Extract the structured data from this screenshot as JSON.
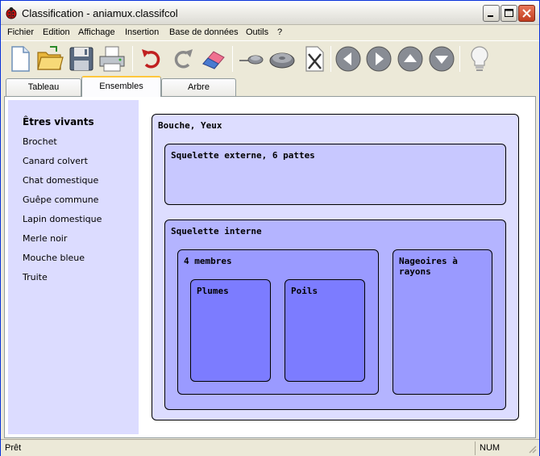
{
  "window": {
    "title": "Classification - aniamux.classifcol"
  },
  "menu": [
    "Fichier",
    "Edition",
    "Affichage",
    "Insertion",
    "Base de données",
    "Outils",
    "?"
  ],
  "toolbar": [
    "new-document-icon",
    "open-folder-icon",
    "save-disk-icon",
    "print-icon",
    "undo-icon",
    "redo-icon",
    "eraser-icon",
    "pin-icon",
    "disc-icon",
    "delete-x-icon",
    "arrow-left-icon",
    "arrow-right-icon",
    "arrow-up-icon",
    "arrow-down-icon",
    "lightbulb-icon"
  ],
  "tabs": [
    "Tableau",
    "Ensembles",
    "Arbre"
  ],
  "active_tab": "Ensembles",
  "sidebar": {
    "title": "Êtres vivants",
    "items": [
      "Brochet",
      "Canard colvert",
      "Chat domestique",
      "Guêpe commune",
      "Lapin domestique",
      "Merle noir",
      "Mouche bleue",
      "Truite"
    ]
  },
  "sets": {
    "outer": {
      "label": "Bouche, Yeux",
      "color": "#ddddff"
    },
    "external": {
      "label": "Squelette externe, 6 pattes",
      "color": "#c8c8ff"
    },
    "internal": {
      "label": "Squelette interne",
      "color": "#b4b4ff"
    },
    "limbs": {
      "label": "4 membres",
      "color": "#9a9aff"
    },
    "fins": {
      "label": "Nageoires à rayons",
      "color": "#9a9aff"
    },
    "feathers": {
      "label": "Plumes",
      "color": "#7c7cff"
    },
    "fur": {
      "label": "Poils",
      "color": "#7c7cff"
    }
  },
  "status": {
    "text": "Prêt",
    "num": "NUM"
  }
}
